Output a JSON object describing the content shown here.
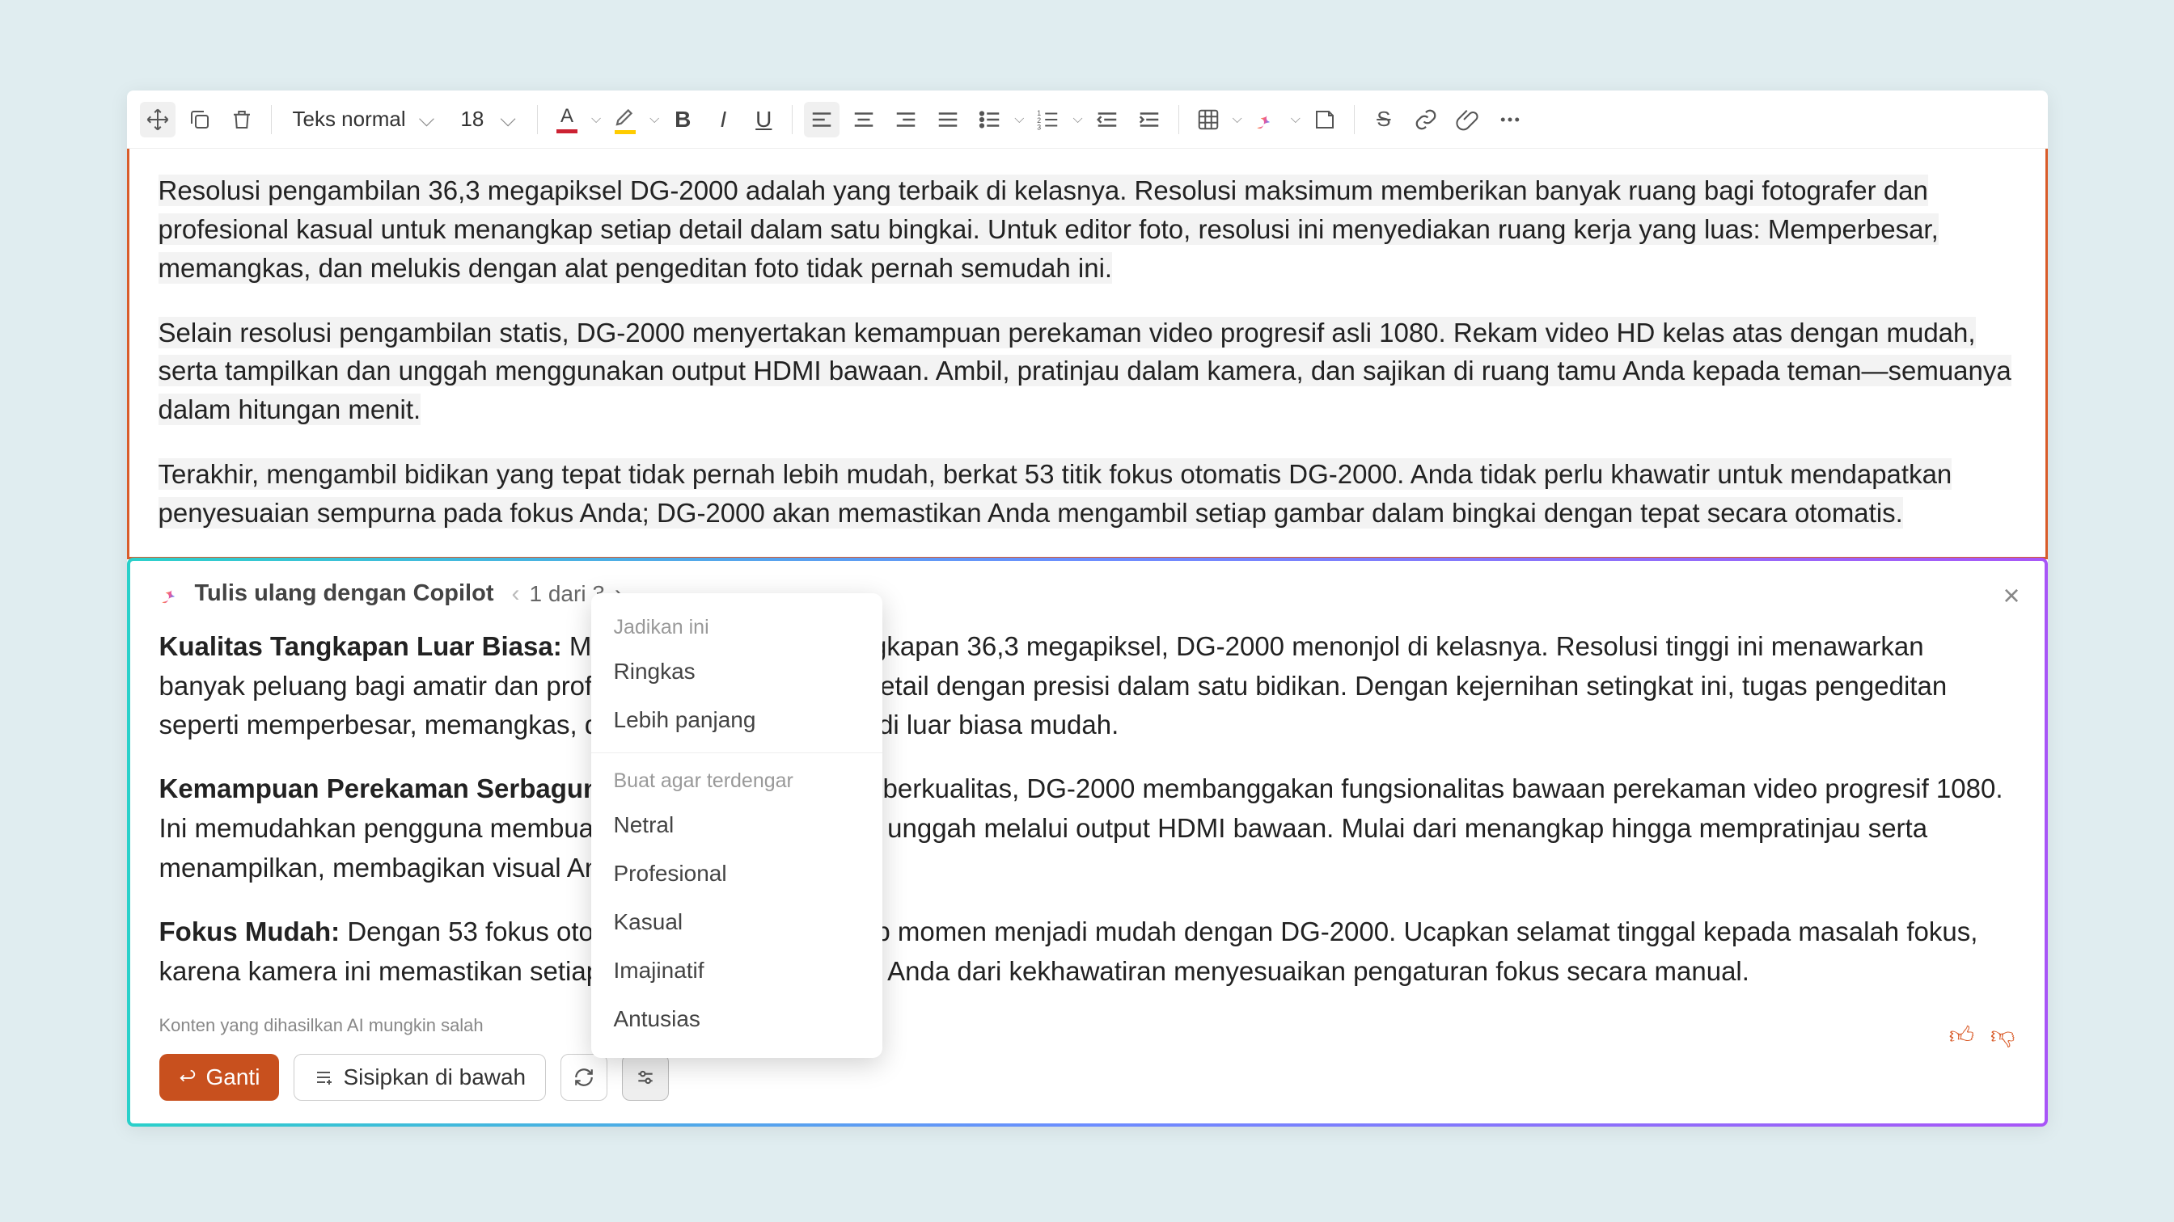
{
  "toolbar": {
    "style": "Teks normal",
    "fontSize": "18"
  },
  "doc": {
    "p1": "Resolusi pengambilan 36,3 megapiksel DG-2000 adalah yang terbaik di kelasnya. Resolusi maksimum memberikan banyak ruang bagi fotografer dan profesional kasual untuk menangkap setiap detail dalam satu bingkai. Untuk editor foto, resolusi ini menyediakan ruang kerja yang luas: Memperbesar, memangkas, dan melukis dengan alat pengeditan foto tidak pernah semudah ini.",
    "p2": "Selain resolusi pengambilan statis, DG-2000 menyertakan kemampuan perekaman video progresif asli 1080. Rekam video HD kelas atas dengan mudah, serta tampilkan dan unggah menggunakan output HDMI bawaan. Ambil, pratinjau dalam kamera, dan sajikan di ruang tamu Anda kepada teman—semuanya dalam hitungan menit.",
    "p3": "Terakhir, mengambil bidikan yang tepat tidak pernah lebih mudah, berkat 53 titik fokus otomatis DG-2000. Anda tidak perlu khawatir untuk mendapatkan penyesuaian sempurna pada fokus Anda; DG-2000 akan memastikan Anda mengambil setiap gambar dalam bingkai dengan tepat secara otomatis."
  },
  "copilot": {
    "title": "Tulis ulang dengan Copilot",
    "count": "1 dari 3",
    "h1": "Kualitas Tangkapan Luar Biasa:",
    "b1": " Menampilkan resolusi tangkapan 36,3 megapiksel, DG-2000 menonjol di kelasnya. Resolusi tinggi ini menawarkan banyak peluang bagi amatir dan profesional  tangkap setiap detail dengan presisi dalam satu bidikan. Dengan kejernihan setingkat ini, tugas pengeditan seperti memperbesar, memangkas, dan memperhalus menjadi luar biasa mudah.",
    "h2": "Kemampuan Perekaman Serbaguna:",
    "b2": " Di luar gambar statis berkualitas, DG-2000 membanggakan fungsionalitas bawaan perekaman video progresif 1080. Ini memudahkan pengguna membuat merekam, melihat, dan unggah melalui output HDMI bawaan. Mulai dari menangkap hingga mempratinjau serta menampilkan, membagikan visual Anda kini tanpa hambatan.",
    "h3": "Fokus Mudah:",
    "b3": " Dengan 53 fokus otomatis, menangkap setiap momen menjadi mudah dengan DG-2000. Ucapkan selamat tinggal kepada masalah fokus, karena kamera ini memastikan setiap gambar membebaskan Anda dari kekhawatiran menyesuaikan pengaturan fokus secara manual.",
    "disclaimer": "Konten yang dihasilkan AI mungkin salah",
    "replace": "Ganti",
    "insert": "Sisipkan di bawah"
  },
  "dropdown": {
    "sec1": "Jadikan ini",
    "opt1": "Ringkas",
    "opt2": "Lebih panjang",
    "sec2": "Buat agar terdengar",
    "opt3": "Netral",
    "opt4": "Profesional",
    "opt5": "Kasual",
    "opt6": "Imajinatif",
    "opt7": "Antusias"
  }
}
